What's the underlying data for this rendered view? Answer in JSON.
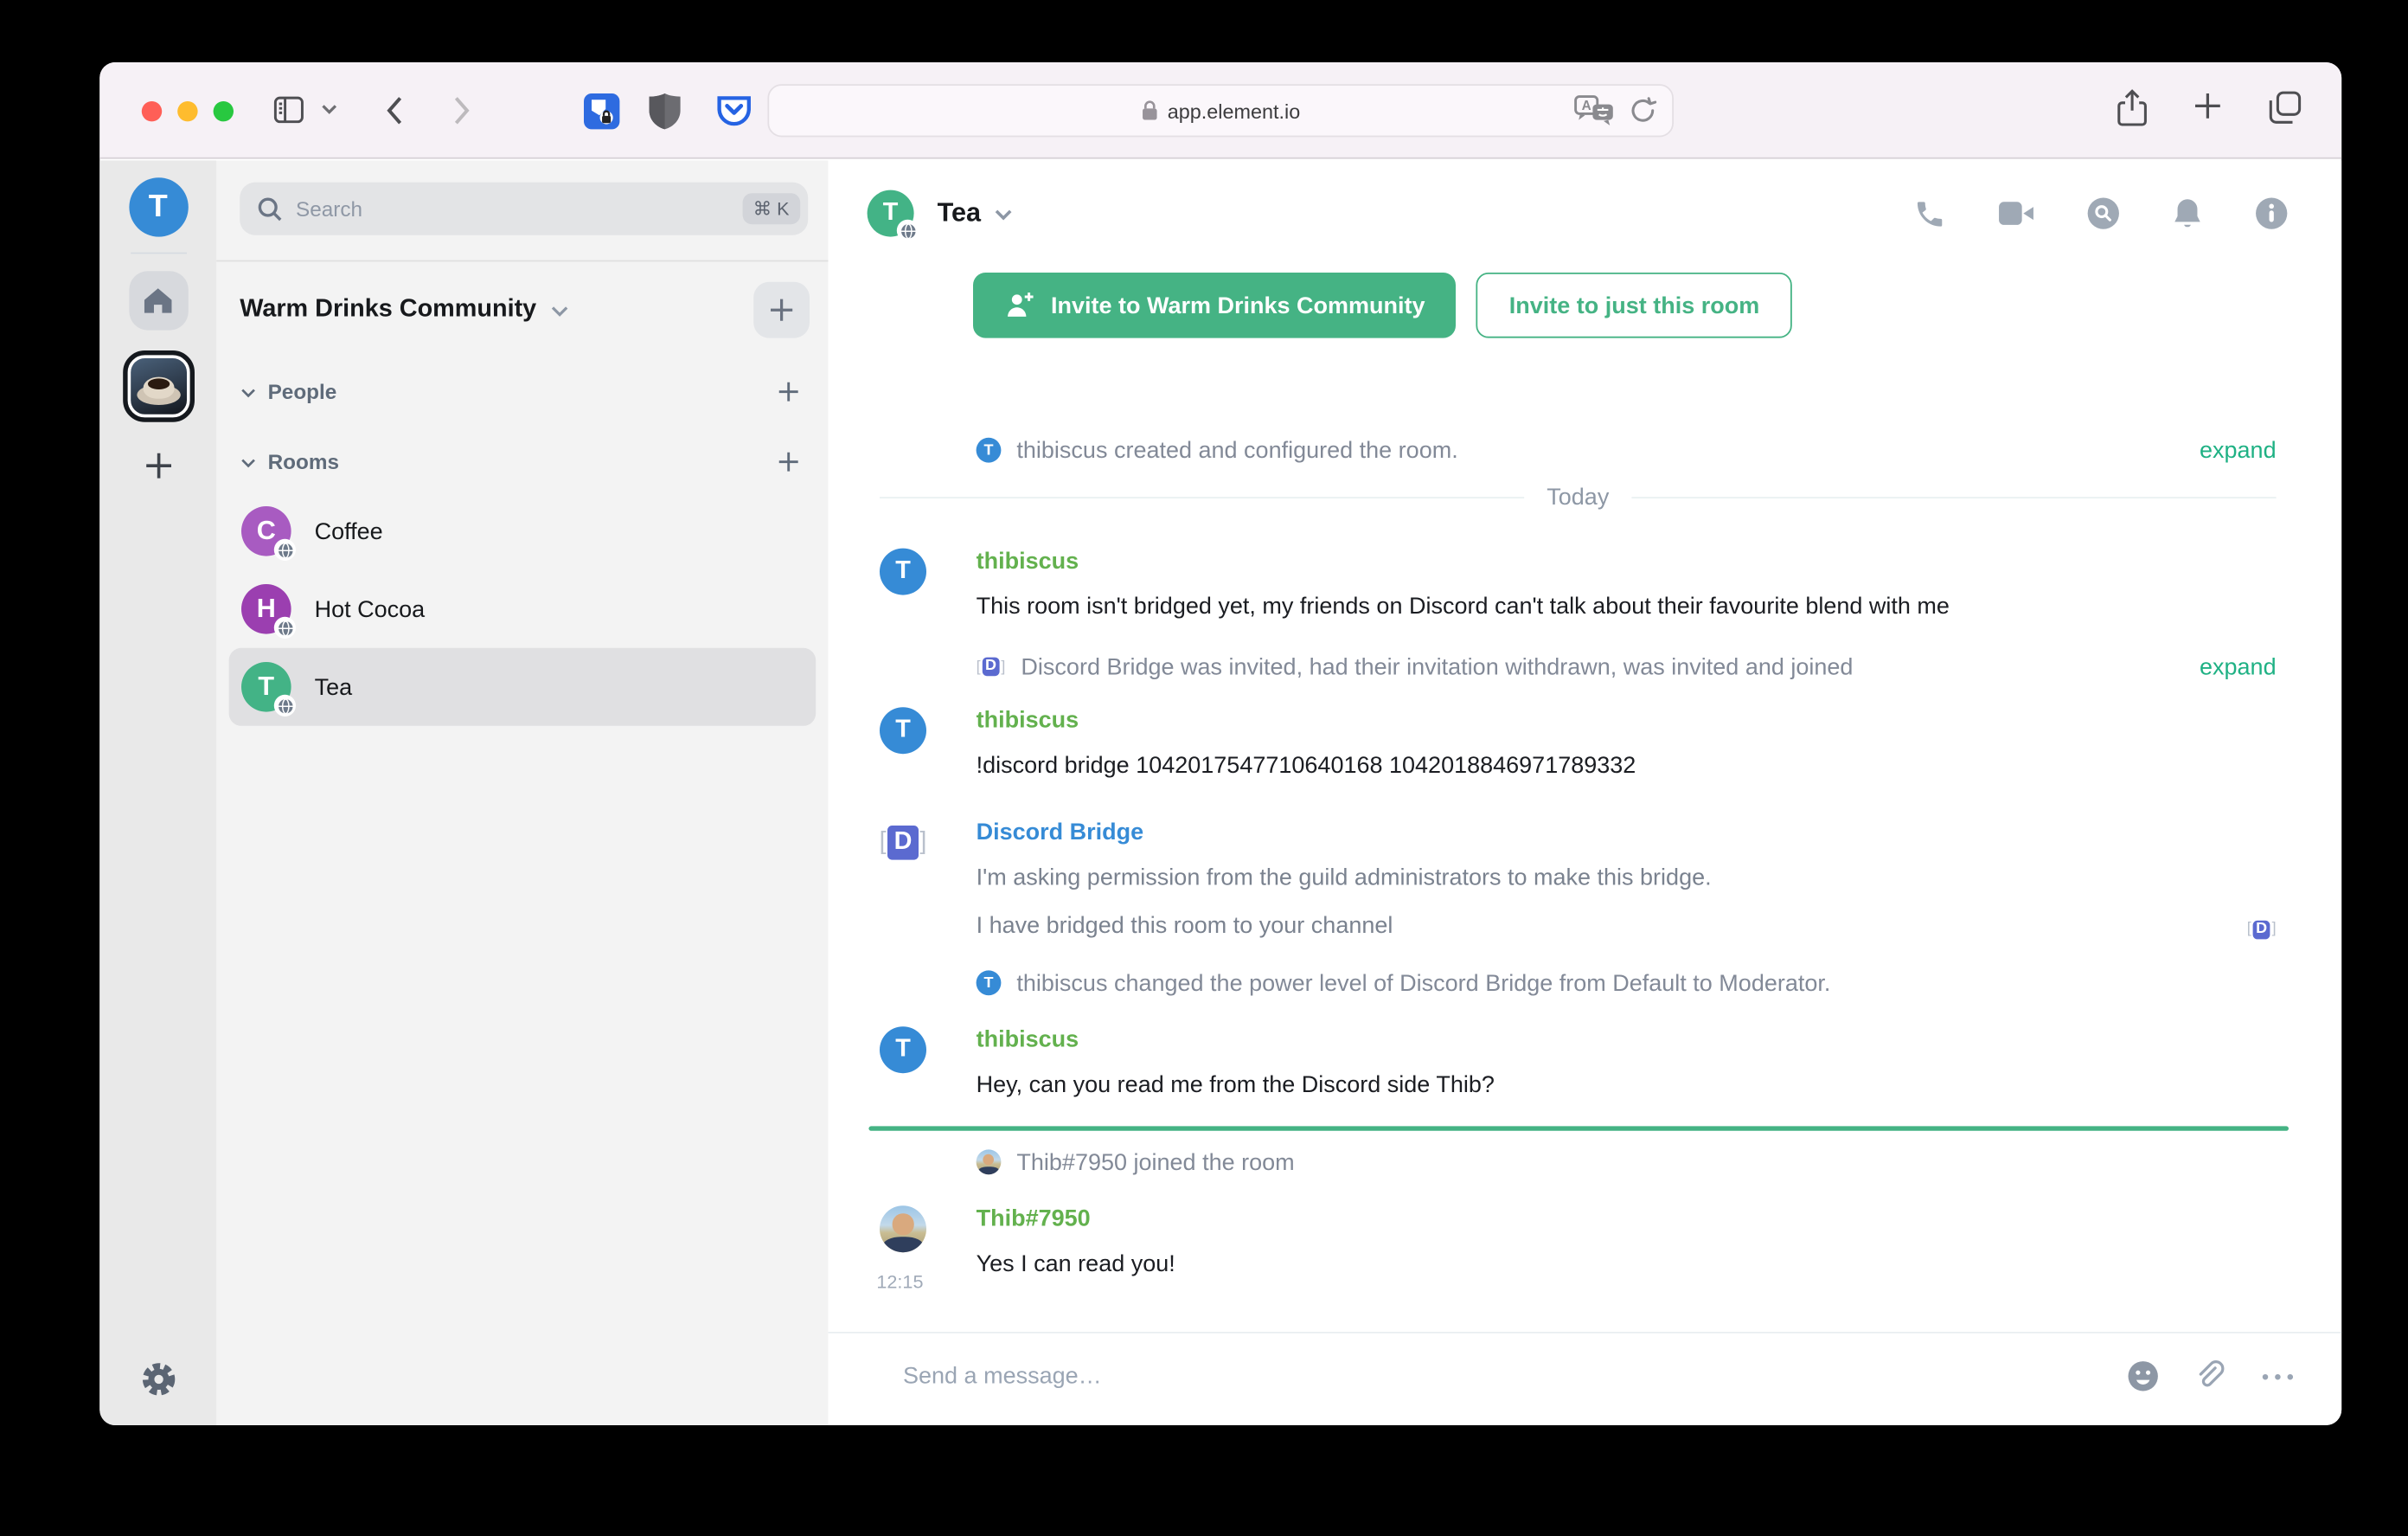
{
  "browser": {
    "url": "app.element.io",
    "search_shortcut_hint": "⌘ K"
  },
  "rail": {
    "user_initial": "T",
    "user_color": "#368bd6"
  },
  "room_list": {
    "search_placeholder": "Search",
    "search_shortcut": "⌘ K",
    "community_name": "Warm Drinks Community",
    "people_label": "People",
    "rooms_label": "Rooms",
    "rooms": [
      {
        "name": "Coffee",
        "initial": "C",
        "color": "#a85bc1"
      },
      {
        "name": "Hot Cocoa",
        "initial": "H",
        "color": "#9b3fb0"
      },
      {
        "name": "Tea",
        "initial": "T",
        "color": "#43b386"
      }
    ]
  },
  "chat": {
    "title": "Tea",
    "room_initial": "T",
    "room_color": "#43b386",
    "accent_green": "#45b384",
    "invite_primary": "Invite to Warm Drinks Community",
    "invite_secondary": "Invite to just this room",
    "expand_label": "expand",
    "timeline": [
      {
        "type": "event",
        "text": "thibiscus created and configured the room."
      },
      {
        "type": "date",
        "text": "Today"
      },
      {
        "type": "message",
        "sender": "thibiscus",
        "sender_color": "#63b14e",
        "text": "This room isn't bridged yet, my friends on Discord can't talk about their favourite blend with me"
      },
      {
        "type": "event",
        "text": "Discord Bridge was invited, had their invitation withdrawn, was invited and joined"
      },
      {
        "type": "message",
        "sender": "thibiscus",
        "sender_color": "#63b14e",
        "text": "!discord bridge 1042017547710640168 1042018846971789332"
      },
      {
        "type": "message",
        "sender": "Discord Bridge",
        "sender_color": "#368bd6",
        "notice": true,
        "lines": [
          "I'm asking permission from the guild administrators to make this bridge.",
          "I have bridged this room to your channel"
        ]
      },
      {
        "type": "event",
        "text": "thibiscus changed the power level of Discord Bridge from Default to Moderator."
      },
      {
        "type": "message",
        "sender": "thibiscus",
        "sender_color": "#63b14e",
        "text": "Hey, can you read me from the Discord side Thib?"
      },
      {
        "type": "unread-marker"
      },
      {
        "type": "event",
        "text": "Thib#7950 joined the room"
      },
      {
        "type": "message",
        "sender": "Thib#7950",
        "sender_color": "#63b14e",
        "time": "12:15",
        "text": "Yes I can read you!"
      }
    ],
    "composer_placeholder": "Send a message…"
  }
}
